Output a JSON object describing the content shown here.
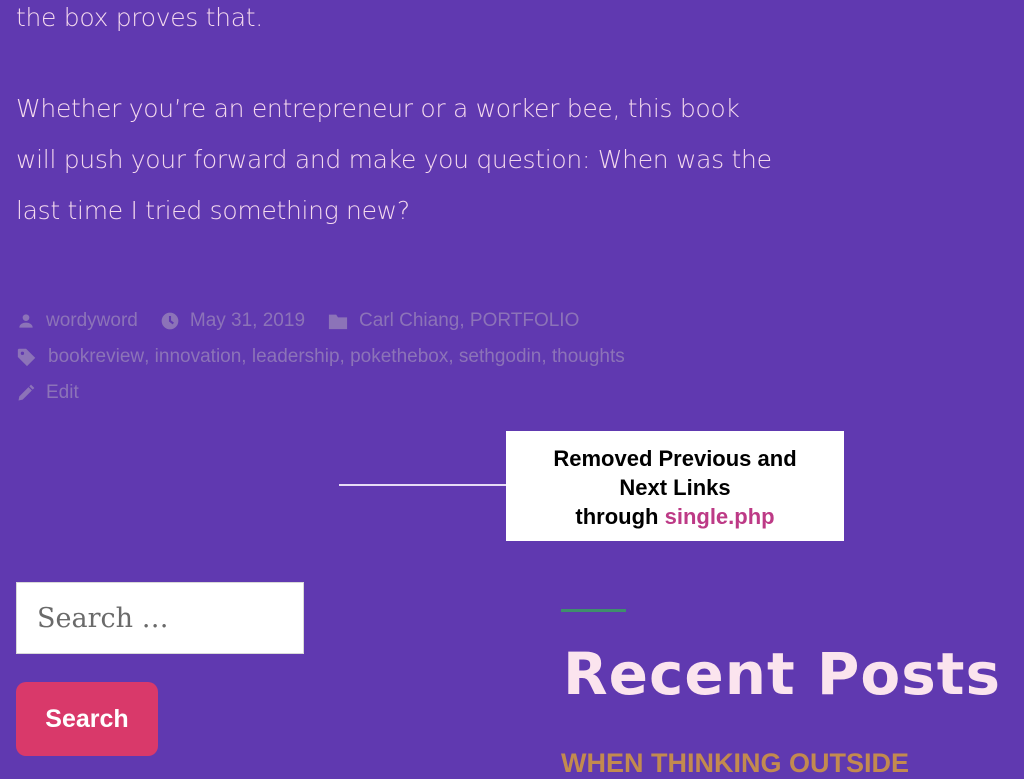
{
  "article": {
    "para1": "the box proves that.",
    "para2": "Whether you’re an entrepreneur or a worker bee,  this book will push your forward and make you question: When was the last time  I tried something new?"
  },
  "meta": {
    "author": "wordyword",
    "date": "May 31, 2019",
    "categories": [
      "Carl Chiang",
      "PORTFOLIO"
    ],
    "tags": [
      "bookreview",
      "innovation",
      "leadership",
      "pokethebox",
      "sethgodin",
      "thoughts"
    ],
    "edit_label": "Edit"
  },
  "annotation": {
    "line1": "Removed Previous and",
    "line2": "Next Links",
    "line3_prefix": "through ",
    "line3_highlight": "single.php"
  },
  "search": {
    "placeholder": "Search …",
    "button_label": "Search"
  },
  "sidebar": {
    "recent_posts_title": "Recent Posts",
    "first_post": "WHEN THINKING OUTSIDE"
  },
  "colors": {
    "background": "#6039b0",
    "text": "#f4d9ee",
    "meta": "#8c73b8",
    "button": "#d9396a",
    "highlight": "#bd3a86",
    "accent_rule": "#3f8f6c"
  },
  "icons": [
    "person-icon",
    "clock-icon",
    "folder-icon",
    "tag-icon",
    "pencil-icon"
  ]
}
